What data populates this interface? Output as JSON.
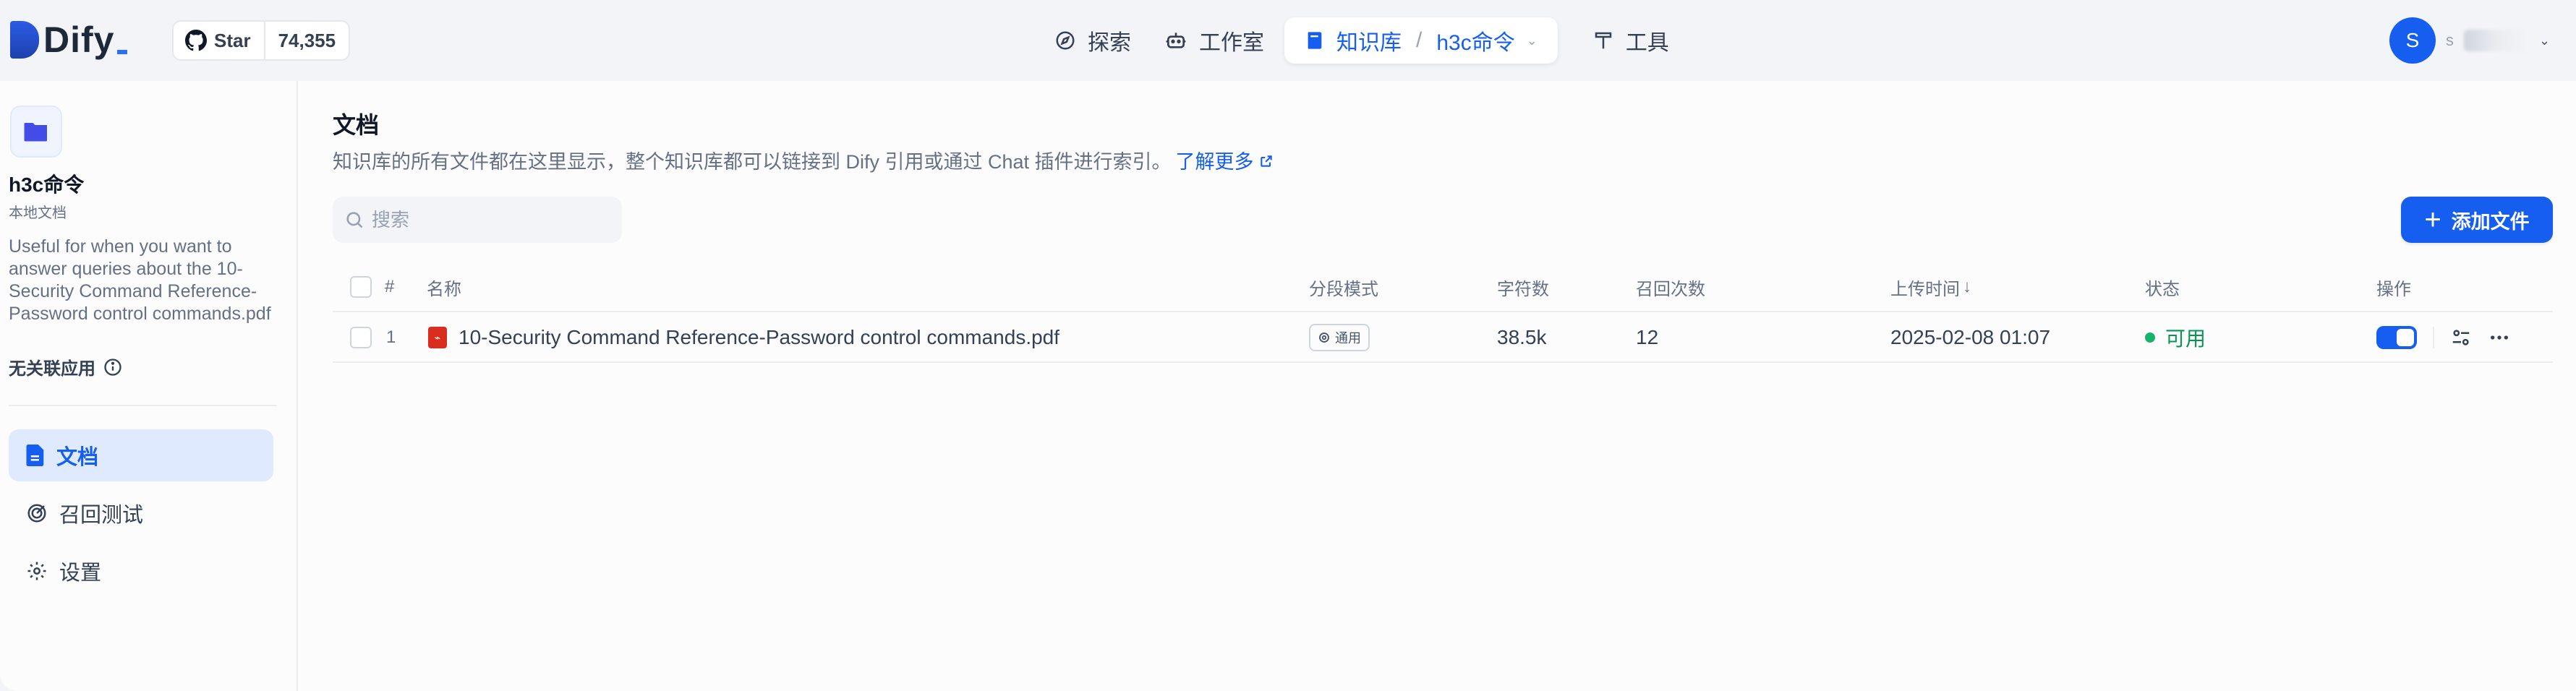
{
  "header": {
    "logo_text": "Dify",
    "github": {
      "star_label": "Star",
      "count": "74,355"
    },
    "nav": [
      {
        "label": "探索",
        "icon": "compass-icon"
      },
      {
        "label": "工作室",
        "icon": "robot-icon"
      },
      {
        "label": "知识库",
        "icon": "book-icon"
      },
      {
        "label": "工具",
        "icon": "hammer-icon"
      }
    ],
    "breadcrumb_sep": "/",
    "dataset_switch": "h3c命令",
    "user_initial": "S",
    "user_name_prefix": "s"
  },
  "sidebar": {
    "dataset_name": "h3c命令",
    "dataset_type": "本地文档",
    "description": "Useful for when you want to answer queries about the 10-Security Command Reference-Password control commands.pdf",
    "related_apps": "无关联应用",
    "menu": [
      {
        "label": "文档",
        "icon": "document-icon",
        "active": true
      },
      {
        "label": "召回测试",
        "icon": "target-icon",
        "active": false
      },
      {
        "label": "设置",
        "icon": "gear-icon",
        "active": false
      }
    ]
  },
  "main": {
    "title": "文档",
    "subtitle": "知识库的所有文件都在这里显示，整个知识库都可以链接到 Dify 引用或通过 Chat 插件进行索引。",
    "learn_more": "了解更多",
    "search_placeholder": "搜索",
    "add_button": "添加文件",
    "table": {
      "headers": {
        "index": "#",
        "name": "名称",
        "mode": "分段模式",
        "chars": "字符数",
        "hits": "召回次数",
        "upload_time": "上传时间",
        "sort_arrow": "↓",
        "status": "状态",
        "actions": "操作"
      },
      "rows": [
        {
          "index": "1",
          "name": "10-Security Command Reference-Password control commands.pdf",
          "mode": "通用",
          "chars": "38.5k",
          "hits": "12",
          "upload_time": "2025-02-08 01:07",
          "status": "可用",
          "enabled": true
        }
      ]
    }
  },
  "colors": {
    "accent": "#155eef",
    "status_ok": "#17b26a",
    "pdf_icon": "#d92d20"
  }
}
